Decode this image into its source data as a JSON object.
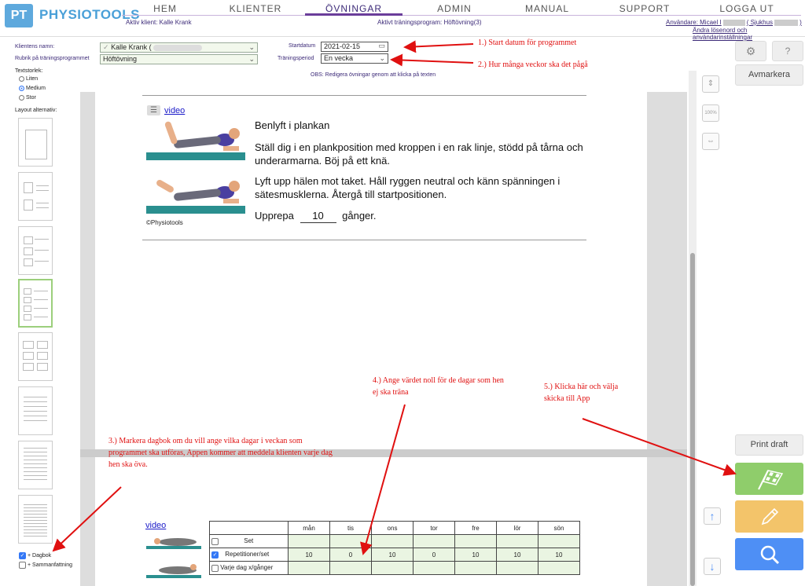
{
  "header": {
    "logo_mark": "PT",
    "logo_text": "PHYSIOTOOLS",
    "nav": [
      "HEM",
      "KLIENTER",
      "ÖVNINGAR",
      "ADMIN",
      "MANUAL",
      "SUPPORT",
      "LOGGA UT"
    ],
    "active_client": "Aktiv klient: Kalle Krank",
    "active_program": "Aktivt träningsprogram: Höftövning(3)",
    "user": "Användare: Micael I",
    "user_unit": "( Sjukhus",
    "settings_link": "Ändra lösenord och användarinställningar"
  },
  "form": {
    "client_label": "Klientens namn:",
    "client_value": "Kalle Krank (",
    "program_label": "Rubrik på träningsprogrammet",
    "program_value": "Höftövning",
    "start_label": "Startdatum",
    "start_value": "2021-02-15",
    "period_label": "Träningsperiod",
    "period_value": "En vecka",
    "obs_text": "OBS: Redigera övningar genom att klicka på texten"
  },
  "textsize": {
    "label": "Textstorlek:",
    "options": [
      "Liten",
      "Medium",
      "Stor"
    ],
    "selected": "Medium"
  },
  "layout": {
    "label": "Layout alternativ:"
  },
  "options": {
    "dagbok": "+ Dagbok",
    "sammanfattning": "+ Sammanfattning"
  },
  "exercise": {
    "video_link": "video",
    "title": "Benlyft i plankan",
    "para1": "Ställ dig i en plankposition med kroppen i en rak linje, stödd på tårna och underarmarna. Böj på ett knä.",
    "para2": "Lyft upp hälen mot taket. Håll ryggen neutral och känn spänningen i sätesmusklerna. Återgå till startpositionen.",
    "repeat_prefix": "Upprepa",
    "repeat_value": "10",
    "repeat_suffix": "gånger.",
    "copyright": "©Physiotools"
  },
  "diary": {
    "video_link": "video",
    "days": [
      "mån",
      "tis",
      "ons",
      "tor",
      "fre",
      "lör",
      "sön"
    ],
    "rows": [
      {
        "label": "Set",
        "checked": false,
        "values": [
          "",
          "",
          "",
          "",
          "",
          "",
          ""
        ]
      },
      {
        "label": "Repetitioner/set",
        "checked": true,
        "values": [
          "10",
          "0",
          "10",
          "0",
          "10",
          "10",
          "10"
        ]
      },
      {
        "label": "Varje dag x/gånger",
        "checked": false,
        "values": [
          "",
          "",
          "",
          "",
          "",
          "",
          ""
        ]
      }
    ]
  },
  "toolbar": {
    "avmarkera": "Avmarkera",
    "print_draft": "Print draft",
    "zoom_label": "100%"
  },
  "annotations": {
    "n1": "1.) Start datum för programmet",
    "n2": "2.) Hur många veckor ska det pågå",
    "n3": "3.) Markera dagbok om du vill ange vilka dagar i veckan som programmet ska utföras, Appen kommer att meddela klienten varje dag hen ska öva.",
    "n4": "4.) Ange värdet noll för de dagar som hen ej ska träna",
    "n5": "5.) Klicka här och välja skicka till App"
  },
  "colors": {
    "accent": "#6a3d9a",
    "brand": "#4aa0d8",
    "send_button": "#8fcd6b",
    "edit_button": "#f3c46a",
    "search_button": "#4e8ff5",
    "annotation": "#e01010"
  }
}
